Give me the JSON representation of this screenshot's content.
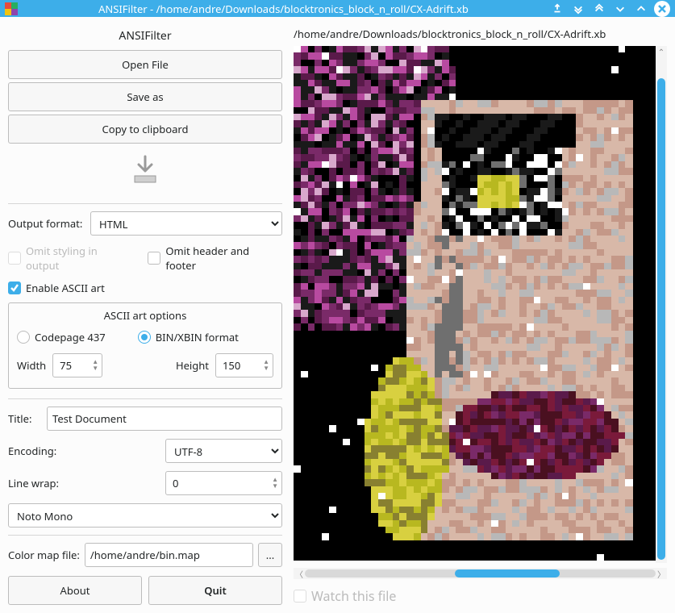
{
  "window": {
    "title": "ANSIFilter - /home/andre/Downloads/blocktronics_block_n_roll/CX-Adrift.xb"
  },
  "left": {
    "heading": "ANSIFilter",
    "open_file": "Open File",
    "save_as": "Save as",
    "copy_clip": "Copy to clipboard",
    "output_format_label": "Output format:",
    "output_format_value": "HTML",
    "omit_styling": "Omit styling in output",
    "omit_header": "Omit header and footer",
    "enable_ascii": "Enable ASCII art",
    "ascii_group_title": "ASCII art options",
    "cp437": "Codepage 437",
    "binxbin": "BIN/XBIN format",
    "width_label": "Width",
    "width_value": "75",
    "height_label": "Height",
    "height_value": "150",
    "title_label": "Title:",
    "title_value": "Test Document",
    "encoding_label": "Encoding:",
    "encoding_value": "UTF-8",
    "linewrap_label": "Line wrap:",
    "linewrap_value": "0",
    "font_value": "Noto Mono",
    "colormap_label": "Color map file:",
    "colormap_value": "/home/andre/bin.map",
    "about": "About",
    "quit": "Quit"
  },
  "right": {
    "path": "/home/andre/Downloads/blocktronics_block_n_roll/CX-Adrift.xb",
    "watch": "Watch this file"
  },
  "state": {
    "omit_styling_checked": false,
    "omit_styling_disabled": true,
    "omit_header_checked": false,
    "enable_ascii_checked": true,
    "radio_selected": "binxbin",
    "watch_checked": false,
    "watch_disabled": true
  },
  "colors": {
    "accent": "#3daee9"
  }
}
